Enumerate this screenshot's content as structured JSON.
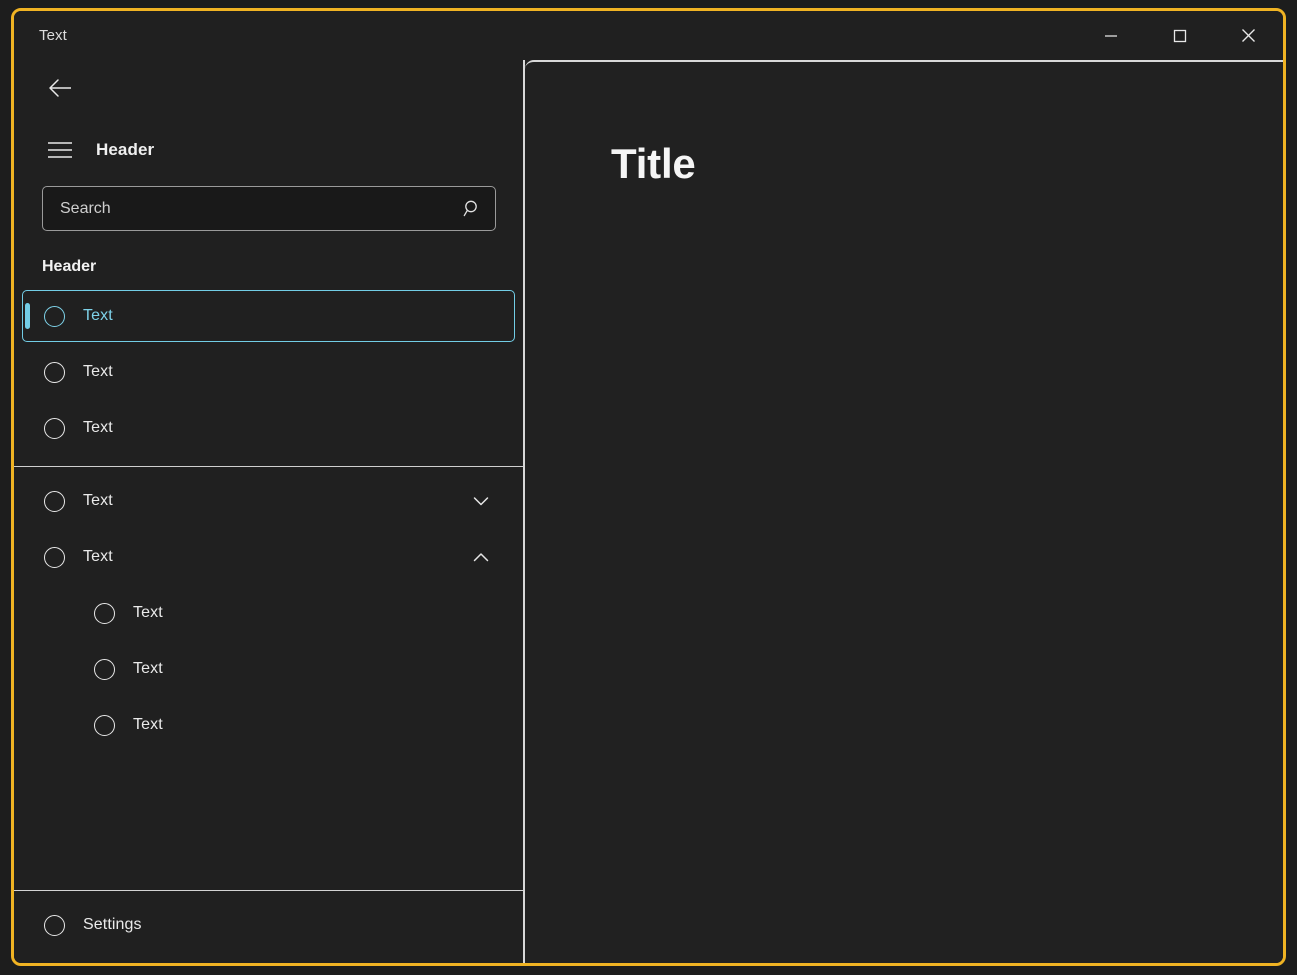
{
  "window": {
    "title": "Text",
    "border_color": "#f0b323",
    "background": "#202020",
    "accent_color": "#72cde6",
    "caption": {
      "minimize_label": "Minimize",
      "maximize_label": "Maximize",
      "close_label": "Close"
    }
  },
  "nav": {
    "back_label": "Back",
    "menu_label": "Menu",
    "header": "Header",
    "search": {
      "placeholder": "Search",
      "value": "",
      "icon_label": "Search"
    },
    "group_header": "Header",
    "items": [
      {
        "label": "Text",
        "icon": "circle-icon",
        "selected": true,
        "level": 0,
        "chevron": ""
      },
      {
        "label": "Text",
        "icon": "circle-icon",
        "selected": false,
        "level": 0,
        "chevron": ""
      },
      {
        "label": "Text",
        "icon": "circle-icon",
        "selected": false,
        "level": 0,
        "chevron": ""
      }
    ],
    "items2": [
      {
        "label": "Text",
        "icon": "circle-icon",
        "selected": false,
        "level": 0,
        "chevron": "chevron-down-icon"
      },
      {
        "label": "Text",
        "icon": "circle-icon",
        "selected": false,
        "level": 0,
        "chevron": "chevron-up-icon"
      },
      {
        "label": "Text",
        "icon": "circle-icon",
        "selected": false,
        "level": 1,
        "chevron": ""
      },
      {
        "label": "Text",
        "icon": "circle-icon",
        "selected": false,
        "level": 1,
        "chevron": ""
      },
      {
        "label": "Text",
        "icon": "circle-icon",
        "selected": false,
        "level": 1,
        "chevron": ""
      }
    ],
    "footer": {
      "label": "Settings",
      "icon": "circle-icon"
    }
  },
  "content": {
    "title": "Title"
  }
}
